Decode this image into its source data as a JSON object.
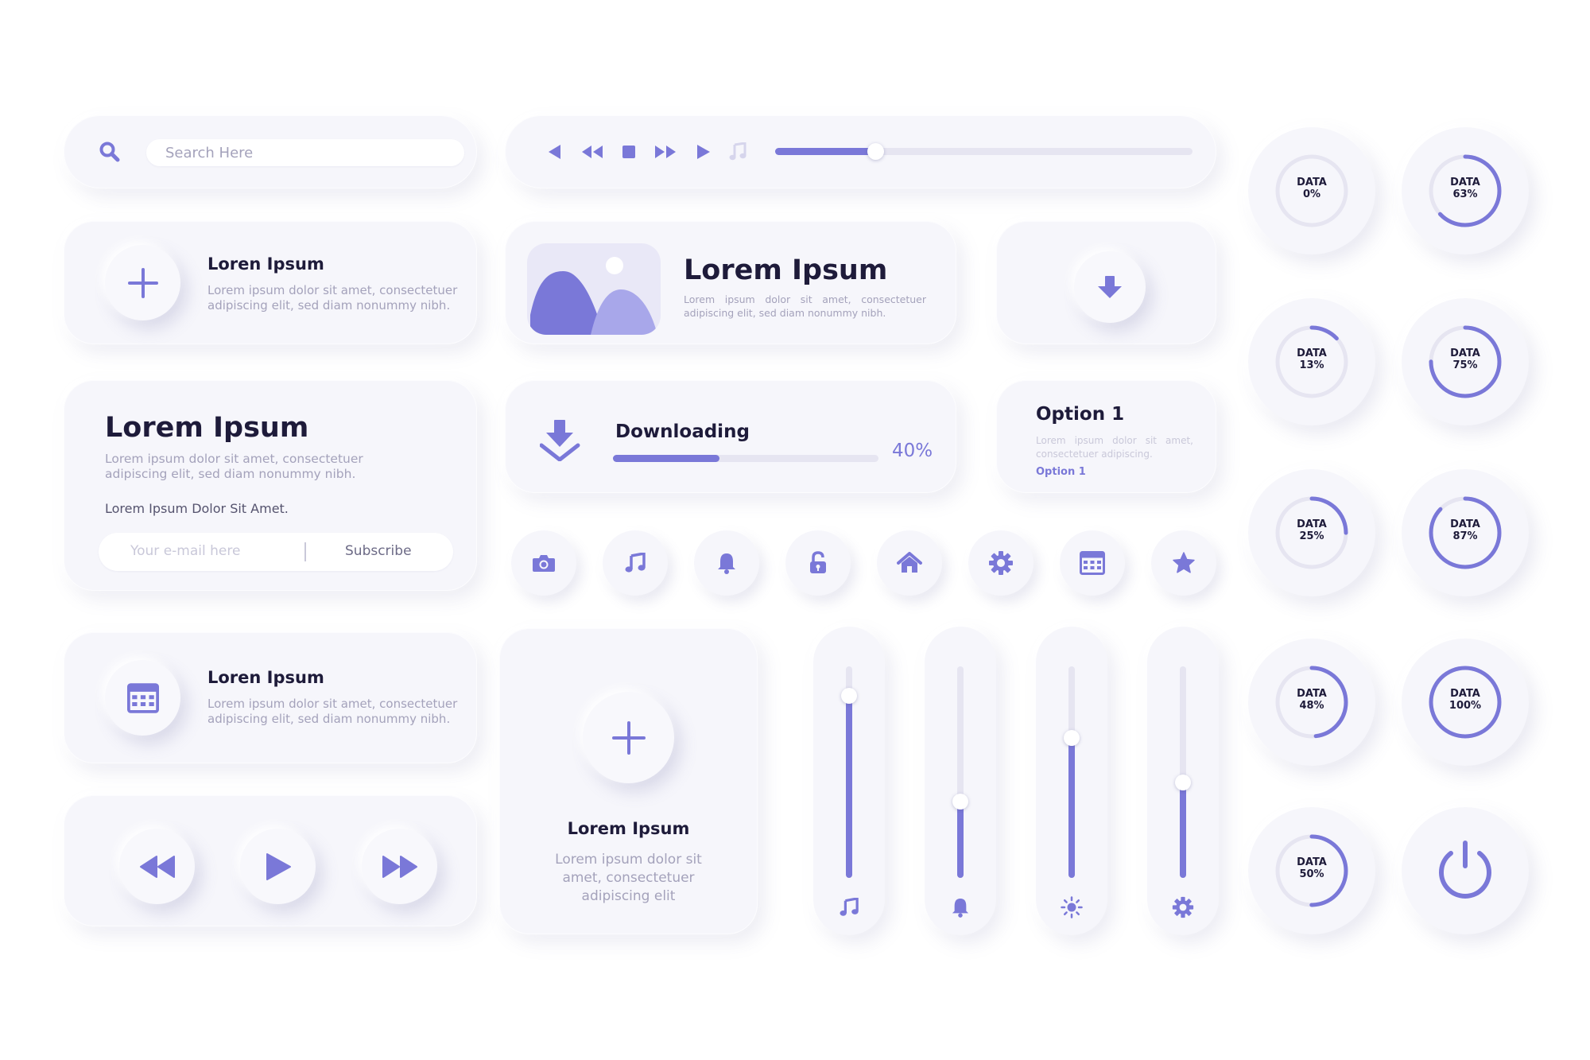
{
  "colors": {
    "accent": "#7a78d8",
    "accent_light": "#a8a7ea",
    "track": "#e6e5f1",
    "card": "#f6f6fb"
  },
  "search": {
    "placeholder": "Search Here"
  },
  "player": {
    "progress": 0.24
  },
  "card_add": {
    "title": "Loren Ipsum",
    "body": "Lorem ipsum dolor sit amet, consectetuer adipiscing elit, sed diam nonummy nibh."
  },
  "image_card": {
    "title": "Lorem Ipsum",
    "body": "Lorem ipsum dolor sit amet, consectetuer adipiscing elit, sed diam nonummy nibh."
  },
  "newsletter": {
    "title": "Lorem Ipsum",
    "body": "Lorem ipsum dolor sit amet, consectetuer adipiscing elit, sed diam nonummy nibh.",
    "tagline": "Lorem Ipsum Dolor Sit Amet.",
    "email_placeholder": "Your e-mail here",
    "subscribe_label": "Subscribe"
  },
  "download": {
    "label": "Downloading",
    "percent_text": "40%",
    "progress": 0.4
  },
  "option": {
    "title": "Option 1",
    "body": "Lorem ipsum dolor sit amet, consectetuer adipiscing.",
    "link": "Option 1"
  },
  "icon_buttons": [
    "camera-icon",
    "music-note-icon",
    "bell-icon",
    "unlock-icon",
    "home-icon",
    "gear-icon",
    "calendar-icon",
    "star-icon"
  ],
  "card_calendar": {
    "title": "Loren Ipsum",
    "body": "Lorem ipsum dolor sit amet, consectetuer adipiscing elit, sed diam nonummy nibh."
  },
  "card_big_add": {
    "title": "Lorem Ipsum",
    "body": "Lorem ipsum dolor sit amet, consectetuer adipiscing elit"
  },
  "sliders": [
    {
      "icon": "music-note-icon",
      "level": 0.86
    },
    {
      "icon": "bell-icon",
      "level": 0.36
    },
    {
      "icon": "brightness-icon",
      "level": 0.66
    },
    {
      "icon": "gear-icon",
      "level": 0.45
    }
  ],
  "gauges": [
    {
      "label": "DATA",
      "value_text": "0%",
      "value": 0
    },
    {
      "label": "DATA",
      "value_text": "63%",
      "value": 0.63
    },
    {
      "label": "DATA",
      "value_text": "13%",
      "value": 0.13
    },
    {
      "label": "DATA",
      "value_text": "75%",
      "value": 0.75
    },
    {
      "label": "DATA",
      "value_text": "25%",
      "value": 0.25
    },
    {
      "label": "DATA",
      "value_text": "87%",
      "value": 0.87
    },
    {
      "label": "DATA",
      "value_text": "48%",
      "value": 0.48
    },
    {
      "label": "DATA",
      "value_text": "100%",
      "value": 1
    },
    {
      "label": "DATA",
      "value_text": "50%",
      "value": 0.5
    }
  ]
}
